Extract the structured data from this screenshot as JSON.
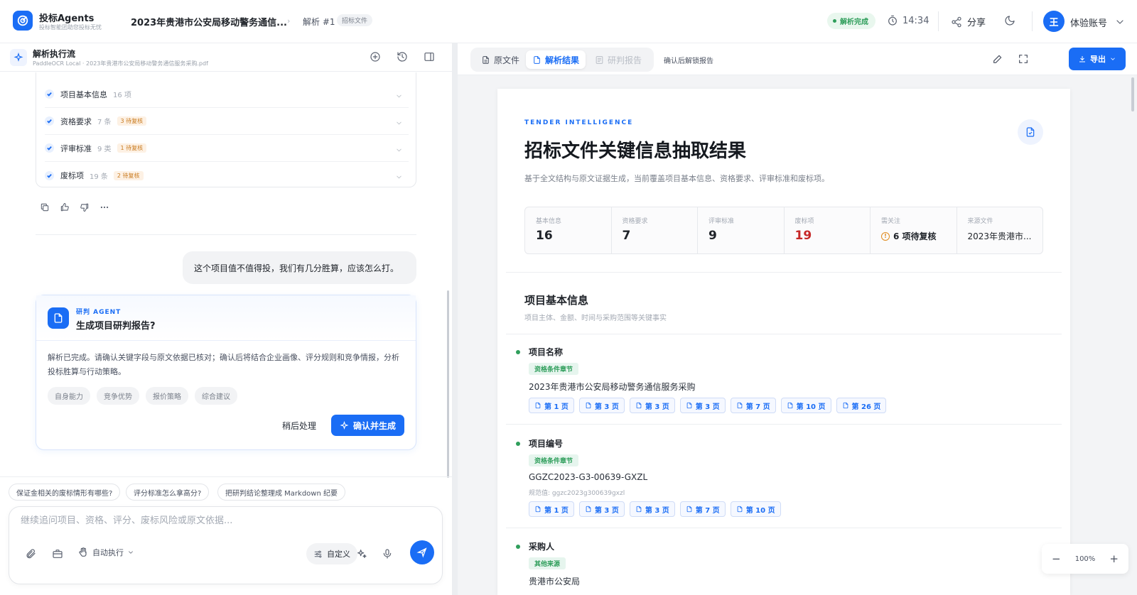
{
  "app": {
    "name": "投标Agents",
    "tagline": "投标智能团助您投标无忧"
  },
  "header": {
    "doc_title": "2023年贵港市公安局移动警务通信...",
    "crumb": "解析 #1",
    "doc_tag": "招标文件",
    "status": "解析完成",
    "timer": "14:34",
    "share": "分享",
    "avatar_initial": "王",
    "account": "体验账号"
  },
  "flow": {
    "title": "解析执行流",
    "subtitle": "PaddleOCR Local · 2023年贵港市公安局移动警务通信服务采购.pdf",
    "checks": [
      {
        "label": "项目基本信息",
        "count": "16 项",
        "badge": ""
      },
      {
        "label": "资格要求",
        "count": "7 条",
        "badge": "3 待复核"
      },
      {
        "label": "评审标准",
        "count": "9 类",
        "badge": "1 待复核"
      },
      {
        "label": "废标项",
        "count": "19 条",
        "badge": "2 待复核"
      }
    ]
  },
  "chat": {
    "user_message": "这个项目值不值得投，我们有几分胜算，应该怎么打。",
    "agent_kicker": "研判 AGENT",
    "agent_title": "生成项目研判报告?",
    "agent_body": "解析已完成。请确认关键字段与原文依据已核对；确认后将结合企业画像、评分规则和竞争情报，分析投标胜算与行动策略。",
    "chips": [
      "自身能力",
      "竞争优势",
      "报价策略",
      "综合建议"
    ],
    "later": "稍后处理",
    "confirm": "确认并生成"
  },
  "suggestions": [
    "保证金相关的废标情形有哪些?",
    "评分标准怎么拿高分?",
    "把研判结论整理成 Markdown 纪要"
  ],
  "composer": {
    "placeholder": "继续追问项目、资格、评分、废标风险或原文依据...",
    "auto_exec": "自动执行",
    "custom": "自定义"
  },
  "viewer": {
    "tabs": [
      "原文件",
      "解析结果",
      "研判报告"
    ],
    "active_tab": "解析结果",
    "unlock_hint": "确认后解锁报告",
    "export": "导出",
    "zoom": "100%"
  },
  "result": {
    "kicker": "TENDER INTELLIGENCE",
    "title": "招标文件关键信息抽取结果",
    "desc": "基于全文结构与原文证据生成，当前覆盖项目基本信息、资格要求、评审标准和废标项。",
    "stats": [
      {
        "label": "基本信息",
        "value": "16"
      },
      {
        "label": "资格要求",
        "value": "7"
      },
      {
        "label": "评审标准",
        "value": "9"
      },
      {
        "label": "废标项",
        "value": "19"
      },
      {
        "label": "需关注",
        "value": "6 项待复核"
      },
      {
        "label": "来源文件",
        "value": "2023年贵港市..."
      }
    ],
    "section_title": "项目基本信息",
    "section_sub": "项目主体、金额、时间与采购范围等关键事实",
    "fields": [
      {
        "name": "项目名称",
        "tag": "资格条件章节",
        "value": "2023年贵港市公安局移动警务通信服务采购",
        "norm": "",
        "pages": [
          "第 1 页",
          "第 3 页",
          "第 3 页",
          "第 3 页",
          "第 7 页",
          "第 10 页",
          "第 26 页"
        ]
      },
      {
        "name": "项目编号",
        "tag": "资格条件章节",
        "value": "GGZC2023-G3-00639-GXZL",
        "norm": "规范值: ggzc2023g300639gxzl",
        "pages": [
          "第 1 页",
          "第 3 页",
          "第 3 页",
          "第 7 页",
          "第 10 页"
        ]
      },
      {
        "name": "采购人",
        "tag": "其他来源",
        "value": "贵港市公安局",
        "norm": "",
        "pages": []
      }
    ]
  },
  "colors": {
    "accent": "#1a6df5",
    "success": "#2f9e5b",
    "warning": "#c97a1e",
    "danger": "#c62828"
  }
}
